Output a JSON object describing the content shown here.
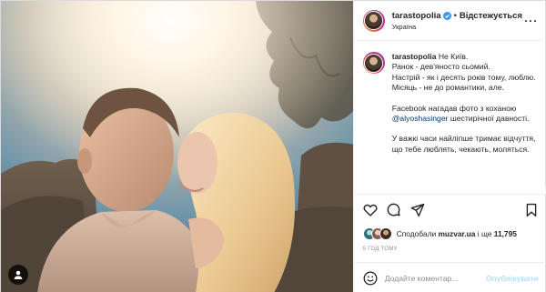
{
  "post": {
    "photo_alt": "",
    "tag_icon": "user-tag-icon"
  },
  "header": {
    "username": "tarastopolia",
    "separator": "•",
    "follow_status": "Відстежується",
    "location": "Україна",
    "more_icon": "more-dots-icon"
  },
  "caption": {
    "username": "tarastopolia",
    "line1": "Не Київ.",
    "line2": "Ранок - дев'яносто сьомий.",
    "line3": "Настрій - як і десять років тому, люблю.",
    "line4": "Місяць - не до романтики, але.",
    "p2_before": "Facebook нагадав фото з коханою",
    "p2_mention": "@alyoshasinger",
    "p2_after": " шестирічної давності.",
    "p3": "У важкі часи найліпше тримає відчуття, що тебе люблять, чекають, моляться."
  },
  "actions": {
    "like_icon": "heart-icon",
    "comment_icon": "comment-bubble-icon",
    "share_icon": "paper-plane-icon",
    "save_icon": "bookmark-icon"
  },
  "likes": {
    "prefix": "Сподобали",
    "account": "muzvar.ua",
    "connector": "і ще",
    "count": "11,795"
  },
  "timestamp": "5 год тому",
  "comment_box": {
    "placeholder": "Додайте коментар...",
    "post_label": "Опублікувати",
    "emoji_icon": "smiley-icon"
  },
  "colors": {
    "link": "#00376b",
    "verified": "#3897f0",
    "post_disabled": "#b2dffc",
    "muted": "#8e8e8e"
  }
}
